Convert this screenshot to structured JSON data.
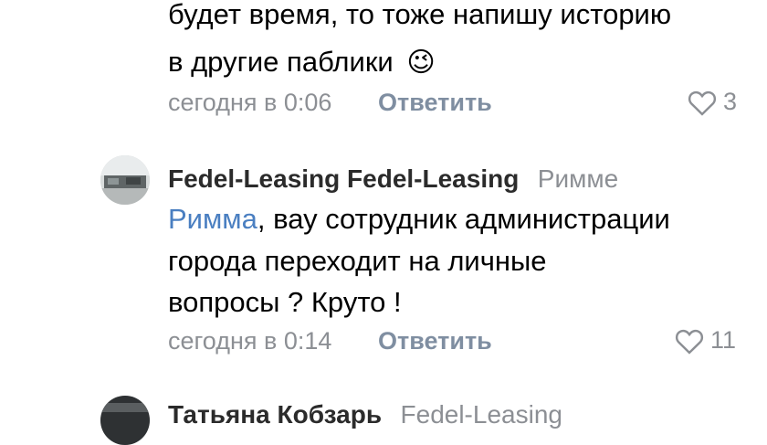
{
  "comment1": {
    "text_line1": "будет время, то тоже напишу историю",
    "text_line2": "в другие паблики",
    "emoji": "😉",
    "time": "сегодня в 0:06",
    "reply_label": "Ответить",
    "likes": "3",
    "icon": "heart-icon"
  },
  "comment2": {
    "author": "Fedel-Leasing Fedel-Leasing",
    "reply_to_prefix": "Римме",
    "mention": "Римма",
    "text_line1_rest": ", вау сотрудник администрации",
    "text_line2": "города переходит на личные",
    "text_line3": "вопросы ? Круто !",
    "time": "сегодня в 0:14",
    "reply_label": "Ответить",
    "likes": "11",
    "avatar": "photo-avatar",
    "icon": "heart-icon"
  },
  "comment3": {
    "author_partial": "Татьяна Кобзарь",
    "reply_to_partial": "Fedel-Leasing",
    "avatar": "photo-avatar"
  }
}
